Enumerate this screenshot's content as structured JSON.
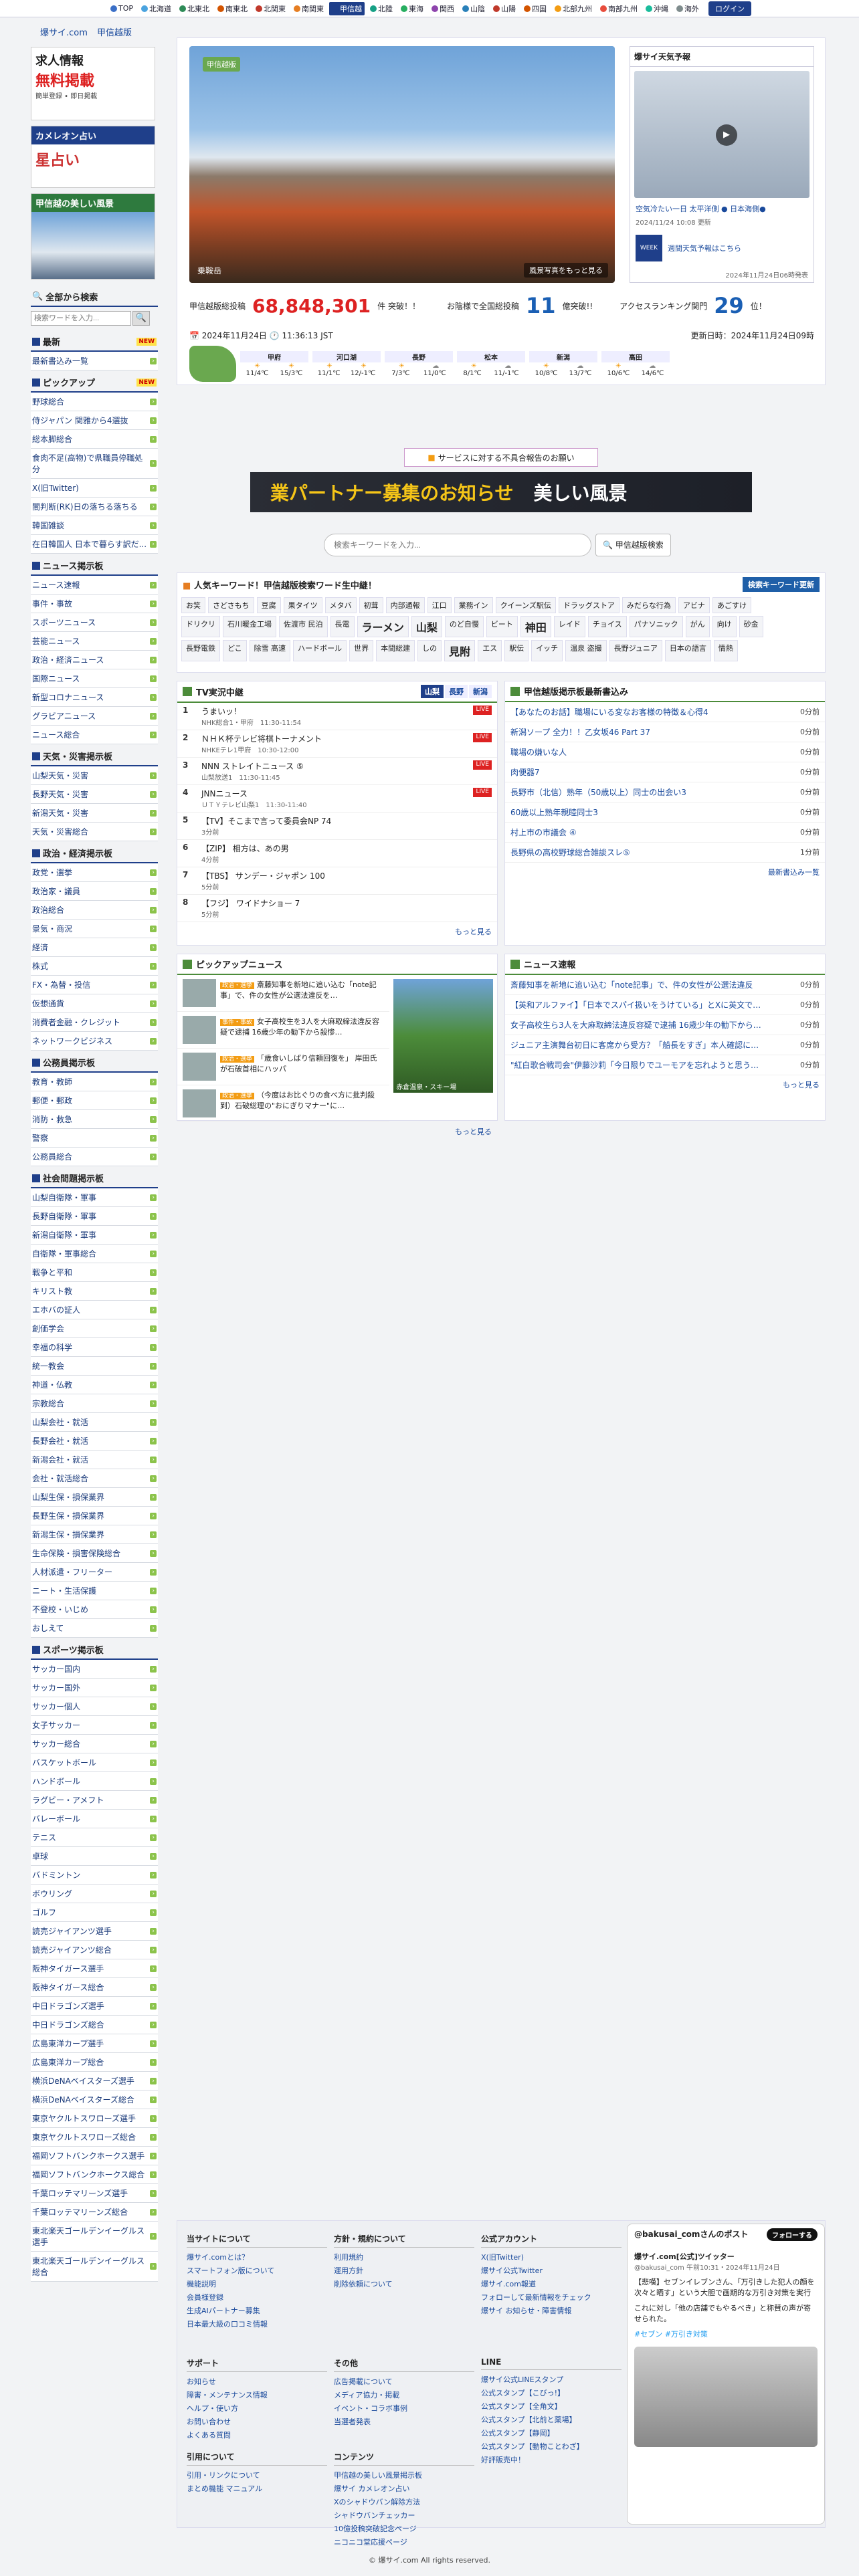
{
  "topbar": {
    "regions": [
      {
        "label": "TOP",
        "color": "#3b6fc7"
      },
      {
        "label": "北海道",
        "color": "#4aa3df"
      },
      {
        "label": "北東北",
        "color": "#2e8b57"
      },
      {
        "label": "南東北",
        "color": "#d35400"
      },
      {
        "label": "北関東",
        "color": "#c0392b"
      },
      {
        "label": "南関東",
        "color": "#e67e22"
      },
      {
        "label": "甲信越",
        "color": "#1f3f8a",
        "active": true
      },
      {
        "label": "北陸",
        "color": "#16a085"
      },
      {
        "label": "東海",
        "color": "#27ae60"
      },
      {
        "label": "関西",
        "color": "#8e44ad"
      },
      {
        "label": "山陰",
        "color": "#2980b9"
      },
      {
        "label": "山陽",
        "color": "#c0392b"
      },
      {
        "label": "四国",
        "color": "#d35400"
      },
      {
        "label": "北部九州",
        "color": "#f39c12"
      },
      {
        "label": "南部九州",
        "color": "#e74c3c"
      },
      {
        "label": "沖縄",
        "color": "#1abc9c"
      },
      {
        "label": "海外",
        "color": "#7f8c8d"
      }
    ],
    "login": "ログイン"
  },
  "breadcrumb": [
    "爆サイ.com",
    "甲信越版"
  ],
  "sidebar": {
    "ad_lines": [
      "求人情報",
      "無料掲載",
      "簡単登録 • 即日掲載"
    ],
    "chameleon_head": "カメレオン占い",
    "star_label": "星占い",
    "scenery_head": "甲信越の美しい風景",
    "search_head": "全部から検索",
    "search_placeholder": "検索ワードを入力...",
    "sections": [
      {
        "title": "最新",
        "new": "NEW",
        "items": [
          "最新書込み一覧"
        ]
      },
      {
        "title": "ピックアップ",
        "new": "NEW",
        "items": [
          "野球総合",
          "侍ジャパン 関雅から4選抜",
          "総本脚総合",
          "食肉不足(高物)で県職員停職処分",
          "X(旧Twitter)",
          "闇判断(RK)日の落ちる落ちる",
          "韓国雑談",
          "在日韓国人 日本で暮らす訳だ..."
        ]
      },
      {
        "title": "ニュース掲示板",
        "items": [
          "ニュース速報",
          "事件・事故",
          "スポーツニュース",
          "芸能ニュース",
          "政治・経済ニュース",
          "国際ニュース",
          "新型コロナニュース",
          "グラビアニュース",
          "ニュース総合"
        ]
      },
      {
        "title": "天気・災害掲示板",
        "items": [
          "山梨天気・災害",
          "長野天気・災害",
          "新潟天気・災害",
          "天気・災害総合"
        ]
      },
      {
        "title": "政治・経済掲示板",
        "items": [
          "政党・選挙",
          "政治家・議員",
          "政治総合",
          "景気・商況",
          "経済",
          "株式",
          "FX・為替・投信",
          "仮想通貨",
          "消費者金融・クレジット",
          "ネットワークビジネス"
        ]
      },
      {
        "title": "公務員掲示板",
        "items": [
          "教育・教師",
          "郵便・郵政",
          "消防・救急",
          "警察",
          "公務員総合"
        ]
      },
      {
        "title": "社会問題掲示板",
        "items": [
          "山梨自衛隊・軍事",
          "長野自衛隊・軍事",
          "新潟自衛隊・軍事",
          "自衛隊・軍事総合",
          "戦争と平和",
          "キリスト教",
          "エホバの証人",
          "創価学会",
          "幸福の科学",
          "統一教会",
          "神道・仏教",
          "宗教総合",
          "山梨会社・就活",
          "長野会社・就活",
          "新潟会社・就活",
          "会社・就活総合",
          "山梨生保・損保業界",
          "長野生保・損保業界",
          "新潟生保・損保業界",
          "生命保険・損害保険総合",
          "人材派遣・フリーター",
          "ニート・生活保護",
          "不登校・いじめ",
          "おしえて"
        ]
      },
      {
        "title": "スポーツ掲示板",
        "items": [
          "サッカー国内",
          "サッカー国外",
          "サッカー個人",
          "女子サッカー",
          "サッカー総合",
          "バスケットボール",
          "ハンドボール",
          "ラグビー・アメフト",
          "バレーボール",
          "テニス",
          "卓球",
          "バドミントン",
          "ボウリング",
          "ゴルフ",
          "読売ジャイアンツ選手",
          "読売ジャイアンツ総合",
          "阪神タイガース選手",
          "阪神タイガース総合",
          "中日ドラゴンズ選手",
          "中日ドラゴンズ総合",
          "広島東洋カープ選手",
          "広島東洋カープ総合",
          "横浜DeNAベイスターズ選手",
          "横浜DeNAベイスターズ総合",
          "東京ヤクルトスワローズ選手",
          "東京ヤクルトスワローズ総合",
          "福岡ソフトバンクホークス選手",
          "福岡ソフトバンクホークス総合",
          "千葉ロッテマリーンズ選手",
          "千葉ロッテマリーンズ総合",
          "東北楽天ゴールデンイーグルス選手",
          "東北楽天ゴールデンイーグルス総合"
        ]
      }
    ]
  },
  "hero": {
    "badge": "甲信越版",
    "caption": "乗鞍岳",
    "more": "風景写真をもっと見る",
    "weather_head": "爆サイ天気予報",
    "weather_video_title": "空気冷たい一日 太平洋側 ● 日本海側●",
    "weather_date": "2024/11/24 10:08 更新",
    "week_label": "WEEK",
    "week_link": "週間天気予報はこちら",
    "week_date": "2024年11月24日06時発表"
  },
  "stats": {
    "label1": "甲信越版総投稿",
    "posts": "68,848,301",
    "unit1": "件 突破！！",
    "label2": "お陰様で全国総投稿",
    "trillion": "11",
    "unit2": "億突破!!",
    "label3": "アクセスランキング関門",
    "rank": "29",
    "unit3": "位！"
  },
  "datebar": {
    "date": "2024年11月24日",
    "time": "11:36:13 JST",
    "updated": "更新日時：2024年11月24日09時"
  },
  "forecast": [
    {
      "name": "甲府",
      "today": "11/4℃",
      "tomorrow": "15/3℃"
    },
    {
      "name": "河口湖",
      "today": "11/1℃",
      "tomorrow": "12/-1℃"
    },
    {
      "name": "長野",
      "today": "7/3℃",
      "tomorrow": "11/0℃"
    },
    {
      "name": "松本",
      "today": "8/1℃",
      "tomorrow": "11/-1℃"
    },
    {
      "name": "新潟",
      "today": "10/8℃",
      "tomorrow": "13/7℃"
    },
    {
      "name": "高田",
      "today": "10/6℃",
      "tomorrow": "14/6℃"
    }
  ],
  "notice": "サービスに対する不具合報告のお願い",
  "partner_banner": {
    "left": "業パートナー募集のお知らせ",
    "right": "美しい風景"
  },
  "bottom_search": {
    "placeholder": "検索キーワードを入力...",
    "button": "甲信越版検索"
  },
  "keywords": {
    "head": "人気キーワード！甲信越版検索ワード生中継！",
    "update": "検索キーワード更新",
    "rows": [
      [
        "お笑",
        "さどさもち",
        "豆腐",
        "果タイツ",
        "メタバ",
        "初茸",
        "内部通報",
        "江口",
        "業務イン",
        "クイーンズ駅伝",
        "ドラッグストア",
        "みだらな行為",
        "アビナ",
        "あごすけ"
      ],
      [
        "ドリクリ",
        "石川暖金工場",
        "佐渡市 民泊",
        "長電",
        "ラーメン",
        "山梨",
        "のど自慢",
        "ビート",
        "神田",
        "レイド",
        "チョイス",
        "パナソニック",
        "がん",
        "向け",
        "砂金"
      ],
      [
        "長野電鉄",
        "どこ",
        "除雪 高速",
        "ハードボール",
        "世界",
        "本間総建",
        "しの",
        "見附",
        "エス",
        "駅伝",
        "イッチ",
        "温泉 盗撮",
        "長野ジュニア",
        "日本の語言",
        "情熱"
      ]
    ]
  },
  "tv_panel": {
    "head": "TV実況中継",
    "tabs": [
      "山梨",
      "長野",
      "新潟"
    ],
    "items": [
      {
        "rank": "1",
        "title": "うまいッ！",
        "sub": "NHK総合1・甲府　11:30-11:54",
        "live": "LIVE"
      },
      {
        "rank": "2",
        "title": "ＮＨＫ杯テレビ将棋トーナメント",
        "sub": "NHKEテレ1甲府　10:30-12:00",
        "live": "LIVE"
      },
      {
        "rank": "3",
        "title": "NNN ストレイトニュース ⑤",
        "sub": "山梨放送1　11:30-11:45",
        "live": "LIVE"
      },
      {
        "rank": "4",
        "title": "JNNニュース",
        "sub": "ＵＴＹテレビ山梨1　11:30-11:40",
        "live": "LIVE"
      },
      {
        "rank": "5",
        "title": "【TV】そこまで言って委員会NP 74",
        "sub": "3分前",
        "live": ""
      },
      {
        "rank": "6",
        "title": "【ZIP】 相方は、あの男",
        "sub": "4分前",
        "live": ""
      },
      {
        "rank": "7",
        "title": "【TBS】 サンデー・ジャポン 100",
        "sub": "5分前",
        "live": ""
      },
      {
        "rank": "8",
        "title": "【フジ】 ワイドナショー 7",
        "sub": "5分前",
        "live": ""
      }
    ],
    "more": "もっと見る"
  },
  "threads_panel": {
    "head": "甲信越版掲示板最新書込み",
    "items": [
      {
        "title": "【あなたのお話】職場にいる変なお客様の特徴＆心得4",
        "count": "0分前"
      },
      {
        "title": "新潟ソープ 全力！！乙女坂46 Part 37",
        "count": "0分前"
      },
      {
        "title": "職場の嫌いな人",
        "count": "0分前"
      },
      {
        "title": "肉便器7",
        "count": "0分前"
      },
      {
        "title": "長野市（北信）熟年（50歳以上）同士の出会い3",
        "count": "0分前"
      },
      {
        "title": "60歳以上熟年親睦同士3",
        "count": "0分前"
      },
      {
        "title": "村上市の市議会 ④",
        "count": "0分前"
      },
      {
        "title": "長野県の高校野球総合雑談スレ⑤",
        "count": "1分前"
      }
    ],
    "more": "最新書込み一覧"
  },
  "pickup_panel": {
    "head": "ピックアップニュース",
    "items": [
      {
        "cat": "政治・選挙",
        "text": "斎藤知事を新地に追い込む「note記事」で、件の女性が公選法違反を…"
      },
      {
        "cat": "事件・事故",
        "text": "女子高校生を3人を大麻取締法違反容疑で逮捕 16歳少年の勧下から殺惨…"
      },
      {
        "cat": "政治・選挙",
        "text": "「歳食いしばり信頼回復を」 岸田氏が石破首相にハッパ"
      },
      {
        "cat": "政治・選挙",
        "text": "（今度はお比ぐりの食べ方に批判殺到）石破総理の\"おにぎりマナー\"に…"
      }
    ],
    "image_caption": "赤倉温泉・スキー場",
    "more": "もっと見る"
  },
  "news_panel": {
    "head": "ニュース速報",
    "items": [
      "斎藤知事を新地に追い込む「note記事」で、件の女性が公選法違反",
      "【英和アルファイ】「日本でスパイ扱いをうけている」とXに英文で…",
      "女子高校生ら3人を大麻取締法違反容疑で逮捕 16歳少年の勧下から…",
      "ジュニア主演舞台初日に客席から受方？「船長をすぎ」本人確認に…",
      "\"紅白歌合戦司会\"伊藤沙莉「今日限りでユーモアを忘れようと思う…"
    ],
    "counts": [
      "0分前",
      "0分前",
      "0分前",
      "0分前",
      "0分前"
    ],
    "more": "もっと見る"
  },
  "footer": {
    "cols": [
      {
        "head": "当サイトについて",
        "items": [
          "爆サイ.comとは？",
          "スマートフォン版について",
          "機能説明",
          "会員様登録",
          "生成AIパートナー募集",
          "日本最大級の口コミ情報"
        ]
      },
      {
        "head": "方針・規約について",
        "items": [
          "利用規約",
          "運用方針",
          "削除依頼について"
        ]
      },
      {
        "head": "公式アカウント",
        "items": [
          "X(旧Twitter)",
          "爆サイ公式Twitter",
          "爆サイ.com報道",
          "フォローして最新情報をチェック",
          "爆サイ お知らせ・障害情報"
        ]
      },
      {
        "head": "サポート",
        "items": [
          "お知らせ",
          "障害・メンテナンス情報",
          "ヘルプ・使い方",
          "お問い合わせ",
          "よくある質問"
        ]
      },
      {
        "head": "その他",
        "items": [
          "広告掲載について",
          "メディア協力・掲載",
          "イベント・コラボ事例",
          "当選者発表"
        ]
      },
      {
        "head": "LINE",
        "items": [
          "爆サイ公式LINEスタンプ",
          "公式スタンプ【こびっ!】",
          "公式スタンプ【全角文】",
          "公式スタンプ【北前と薬場】",
          "公式スタンプ【静岡】",
          "公式スタンプ【動物ことわざ】",
          "好評販売中！"
        ]
      },
      {
        "head": "引用について",
        "items": [
          "引用・リンクについて",
          "まとめ機能 マニュアル"
        ]
      },
      {
        "head": "コンテンツ",
        "items": [
          "甲信越の美しい風景掲示板",
          "爆サイ カメレオン占い",
          "Xのシャドウバン解除方法",
          "シャドウバンチェッカー",
          "10億投稿突破記念ページ",
          "ニコニコ堂応援ページ"
        ]
      }
    ],
    "twitter": {
      "head": "@bakusai_comさんのポスト",
      "follow": "フォローする",
      "name": "爆サイ.com[公式]ツイッター",
      "handle": "@bakusai_com 午前10:31・2024年11月24日",
      "text": "【悲嘆】セブンイレブンさん、「万引きした犯人の顔を次々と晒す」という大胆で画期的な万引き対策を実行",
      "text2": "これに対し「他の店舗でもやるべき」と称賛の声が寄せられた。",
      "tags": "#セブン #万引き対策"
    }
  },
  "copyright": "© 爆サイ.com All rights reserved."
}
